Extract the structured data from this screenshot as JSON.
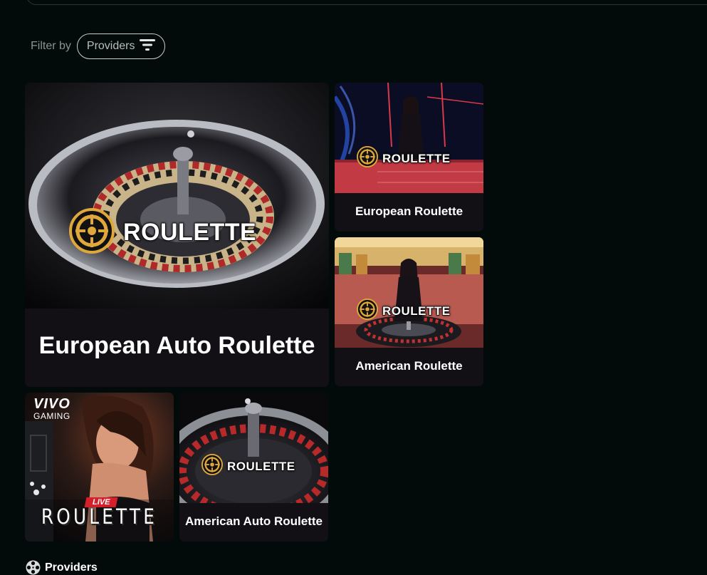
{
  "filter": {
    "label": "Filter by",
    "button_label": "Providers"
  },
  "games": [
    {
      "title": "European Auto Roulette",
      "badge": "ROULETTE"
    },
    {
      "title": "European Roulette",
      "badge": "ROULETTE"
    },
    {
      "title": "American Roulette",
      "badge": "ROULETTE"
    },
    {
      "title": "",
      "brand_top": "VIVO",
      "brand_bottom": "GAMING",
      "tag": "LIVE",
      "badge": "ROULETTE"
    },
    {
      "title": "American Auto Roulette",
      "badge": "ROULETTE"
    }
  ],
  "providers_section": {
    "heading": "Providers"
  },
  "icons": {
    "filter": "filter-lines-icon",
    "roulette_logo": "roulette-wheel-icon",
    "providers": "film-reel-icon"
  },
  "colors": {
    "background": "#030b0a",
    "tile_bg": "#121015",
    "badge_gold": "#e0a83a",
    "live_red": "#d4202a"
  }
}
